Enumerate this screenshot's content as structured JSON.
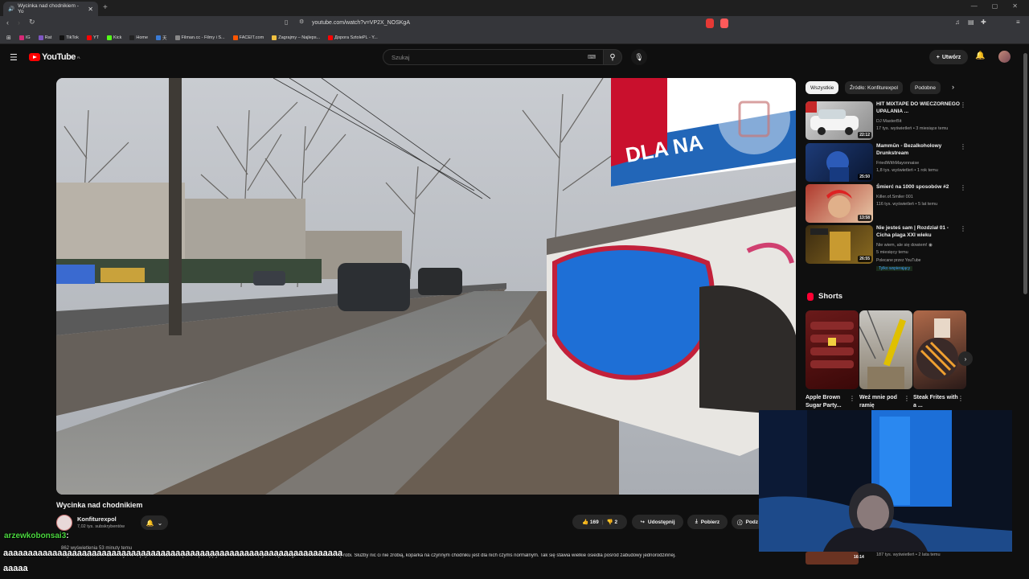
{
  "browser": {
    "tab_title": "Wycinka nad chodnikiem - Yo",
    "url": "youtube.com/watch?v=VP2X_NOSKgA",
    "bookmarks": [
      {
        "label": "IG",
        "color": "#d62976"
      },
      {
        "label": "Rat",
        "color": "#7e57c2"
      },
      {
        "label": "TikTok",
        "color": "#111111"
      },
      {
        "label": "YT",
        "color": "#ff0000"
      },
      {
        "label": "Kick",
        "color": "#53fc18"
      },
      {
        "label": "Home",
        "color": "#222222"
      },
      {
        "label": "天",
        "color": "#3a7bd5"
      },
      {
        "label": "Filman.cc - Filmy i S...",
        "color": "#888888"
      },
      {
        "label": "FACEIT.com",
        "color": "#ff5500"
      },
      {
        "label": "Zagrajmy – Najleps...",
        "color": "#f0c040"
      },
      {
        "label": "Дорога SztolePL - Y...",
        "color": "#ff0000"
      }
    ]
  },
  "header": {
    "logo": "YouTube",
    "region": "PL",
    "search_placeholder": "Szukaj",
    "create_label": "Utwórz"
  },
  "video": {
    "title": "Wycinka nad chodnikiem",
    "channel": "Konfiturexpol",
    "subscribers": "7,02 tys. subskrybentów",
    "likes": "169",
    "dislikes": "2",
    "share_label": "Udostępnij",
    "download_label": "Pobierz",
    "save_label": "Podz",
    "views": "862 wyświetlenia  53 minuty temu",
    "description": "Najbliższe otoczenie zanieczyścić w poprzek chodnika będzie sądziłający. Nie ma odchodze, tylko Moja Droga i Kłamstwo tak to się robi. Służby nic ci nie zrobią, koparka na czynnym chodniku jest dla nich czymś normalnym. Tak się stawia wielkie osiedla pośród zabudowy jednorodzinnej."
  },
  "chips": [
    "Wszystkie",
    "Źródło: Konfiturexpol",
    "Podobne"
  ],
  "recommendations": [
    {
      "title": "HIT MIXTAPE DO WIECZORNEGO UPALANIA ...",
      "channel": "DJ MasterBit",
      "meta": "17 tys. wyświetleń • 3 miesiące temu",
      "duration": "22:12"
    },
    {
      "title": "Mammūn - Bezalkoholowy Drunkstream",
      "channel": "FriedWithMayonnaise",
      "meta": "1,8 tys. wyświetleń • 1 rok temu",
      "duration": "25:50"
    },
    {
      "title": "Śmierć na 1000 sposobów #2",
      "channel": "Killer.of.Smiler 001",
      "meta": "116 tys. wyświetleń • 5 lat temu",
      "duration": "13:58"
    },
    {
      "title": "Nie jesteś sam | Rozdział 01 - Cicha plaga XXI wieku",
      "channel": "Nie wiem, ale się dowiem! ◉",
      "meta": "5 miesięcy temu",
      "duration": "26:55",
      "promoted": "Polecane przez YouTube",
      "members": "Tylko wspierający"
    }
  ],
  "shorts": {
    "heading": "Shorts",
    "items": [
      {
        "title": "Apple Brown Sugar Party..."
      },
      {
        "title": "Weź mnie pod ramię"
      },
      {
        "title": "Steak Frites with a ..."
      }
    ]
  },
  "bottom_rec": {
    "duration": "16:14",
    "meta": "187 tys. wyświetleń • 2 lata temu"
  },
  "chat": {
    "user": "arzewkobonsai3",
    "line1": "aaaaaaaaaaaaaaaaaaaaaaaaaaaaaaaaaaaaaaaaaaaaaaaaaaaaaaaaaaaaaaaaaaaaa",
    "line2": "aaaaa"
  },
  "colors": {
    "bg": "#0f0f0f",
    "accent": "#ff0000",
    "chat_name": "#4bd63f"
  }
}
